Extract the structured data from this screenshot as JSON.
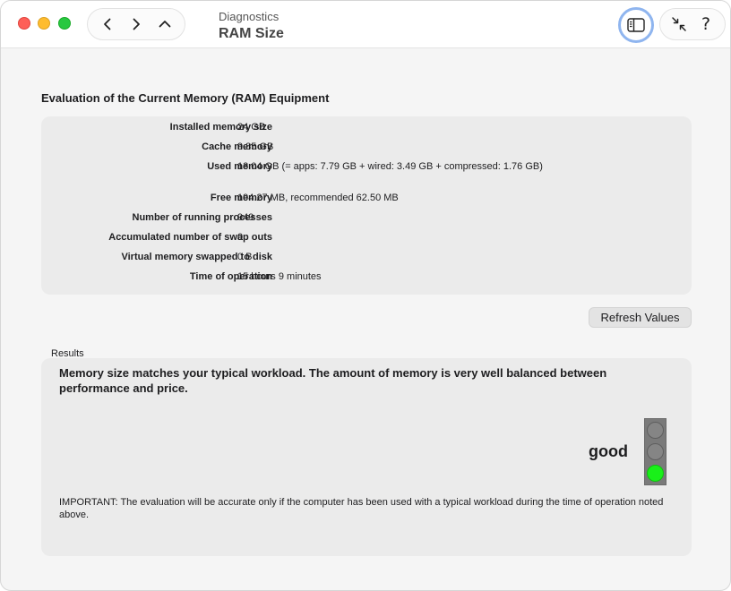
{
  "window": {
    "subtitle": "Diagnostics",
    "title": "RAM Size"
  },
  "toolbar": {
    "back_icon": "chevron-left-icon",
    "forward_icon": "chevron-right-icon",
    "up_icon": "chevron-up-icon",
    "sidebar_icon": "sidebar-icon",
    "collapse_icon": "collapse-arrows-icon",
    "help_label": "?"
  },
  "evaluation": {
    "heading": "Evaluation of the Current Memory (RAM) Equipment",
    "rows": [
      {
        "label": "Installed memory size",
        "value": "24 GB"
      },
      {
        "label": "Cache memory",
        "value": "9.85 GB"
      },
      {
        "label": "Used memory",
        "value": "13.04 GB (= apps: 7.79 GB + wired: 3.49 GB + compressed: 1.76 GB)"
      },
      {
        "label": "Free memory",
        "value": "194.27 MB, recommended 62.50 MB"
      },
      {
        "label": "Number of running processes",
        "value": "949"
      },
      {
        "label": "Accumulated number of swap outs",
        "value": "0"
      },
      {
        "label": "Virtual memory swapped to disk",
        "value": "0  B"
      },
      {
        "label": "Time of operation",
        "value": "15 hours 9 minutes"
      }
    ]
  },
  "refresh_label": "Refresh Values",
  "results": {
    "label": "Results",
    "message": "Memory size matches your typical workload. The amount of memory is very well balanced between performance and price.",
    "rating": "good",
    "note": "IMPORTANT: The evaluation will be accurate only if the computer has been used with a typical workload during the time of operation noted above."
  },
  "colors": {
    "lamp_active": "#19f019",
    "lamp_inactive": "#858585",
    "close": "#fe5f57",
    "minimize": "#febc2e",
    "zoom": "#28c840",
    "focus_ring": "#8fb5ef"
  }
}
